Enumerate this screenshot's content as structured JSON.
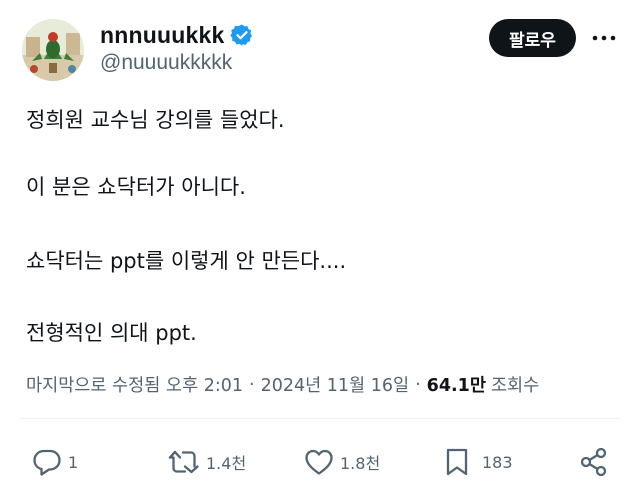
{
  "user": {
    "display_name": "nnnuuukkk",
    "handle": "@nuuuukkkkk",
    "follow_label": "팔로우"
  },
  "tweet": {
    "lines": [
      "정희원 교수님 강의를 들었다.",
      "이 분은 쇼닥터가 아니다.",
      "쇼닥터는 ppt를 이렇게 안 만든다....",
      "전형적인 의대 ppt."
    ]
  },
  "meta": {
    "edited_time": "마지막으로 수정됨 오후 2:01",
    "separator": "·",
    "date": "2024년 11월 16일",
    "views_count": "64.1만",
    "views_label": "조회수"
  },
  "actions": {
    "reply_count": "1",
    "retweet_count": "1.4천",
    "like_count": "1.8천",
    "bookmark_count": "183"
  },
  "colors": {
    "text": "#0f1419",
    "secondary": "#536471",
    "verified": "#1d9bf0",
    "button_bg": "#0f1419"
  },
  "icons": [
    "verified-badge-icon",
    "more-icon",
    "reply-icon",
    "retweet-icon",
    "like-icon",
    "bookmark-icon",
    "share-icon"
  ]
}
